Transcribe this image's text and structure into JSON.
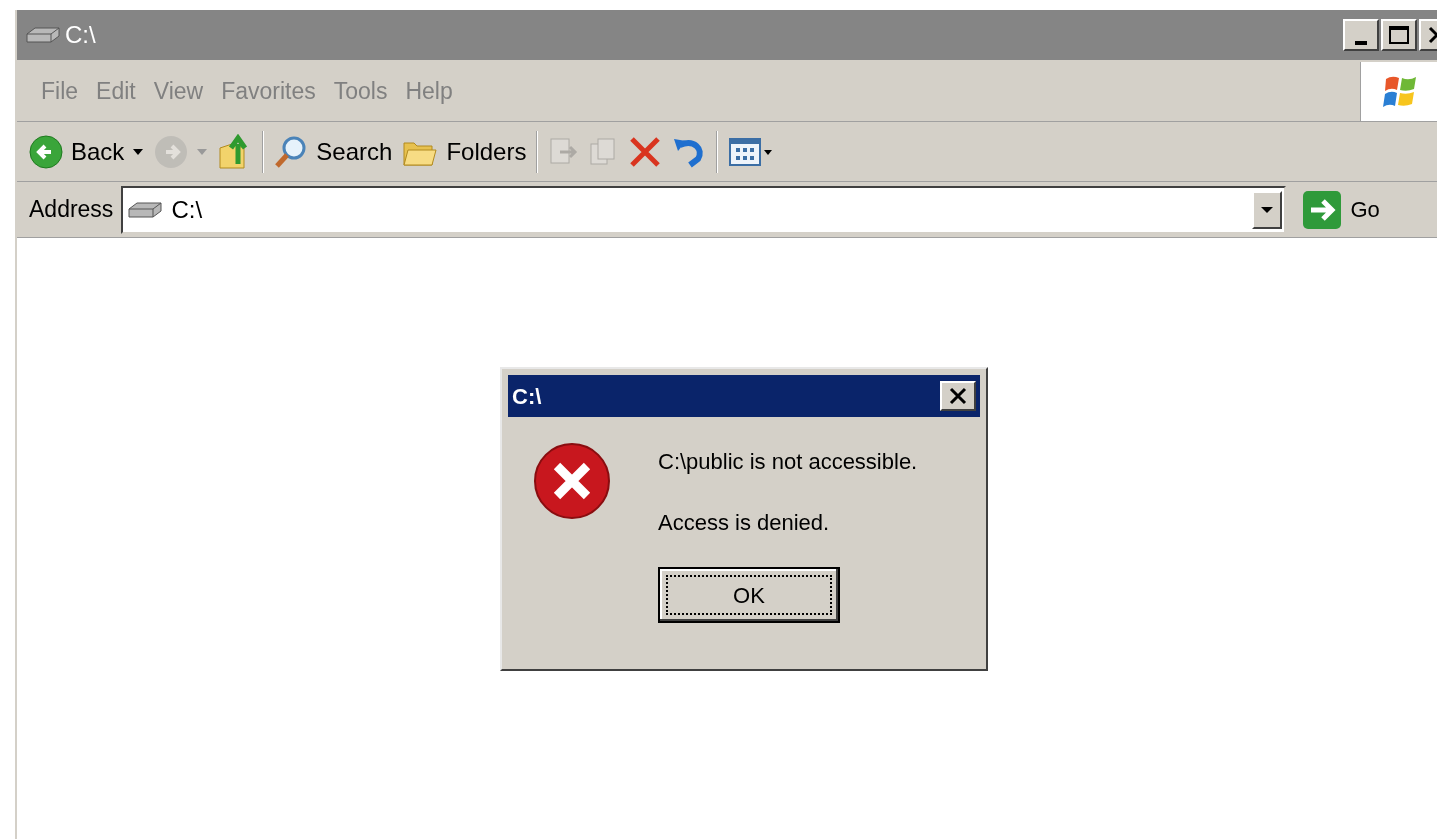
{
  "window": {
    "title": "C:\\"
  },
  "menu": [
    "File",
    "Edit",
    "View",
    "Favorites",
    "Tools",
    "Help"
  ],
  "toolbar": [
    {
      "kind": "back",
      "label": "Back",
      "disabled": false
    },
    {
      "kind": "forward",
      "disabled": true
    },
    {
      "kind": "up",
      "disabled": false
    },
    {
      "kind": "search",
      "label": "Search",
      "disabled": false
    },
    {
      "kind": "folders",
      "label": "Folders",
      "disabled": false
    },
    {
      "kind": "move",
      "disabled": true
    },
    {
      "kind": "copy",
      "disabled": true
    },
    {
      "kind": "delete",
      "disabled": false
    },
    {
      "kind": "undo",
      "disabled": false
    },
    {
      "kind": "views",
      "disabled": false
    }
  ],
  "address": {
    "label": "Address",
    "value": "C:\\",
    "go": "Go"
  },
  "dialog": {
    "title": "C:\\",
    "messages": [
      "C:\\public is not accessible.",
      "Access is denied."
    ],
    "button": "OK"
  }
}
